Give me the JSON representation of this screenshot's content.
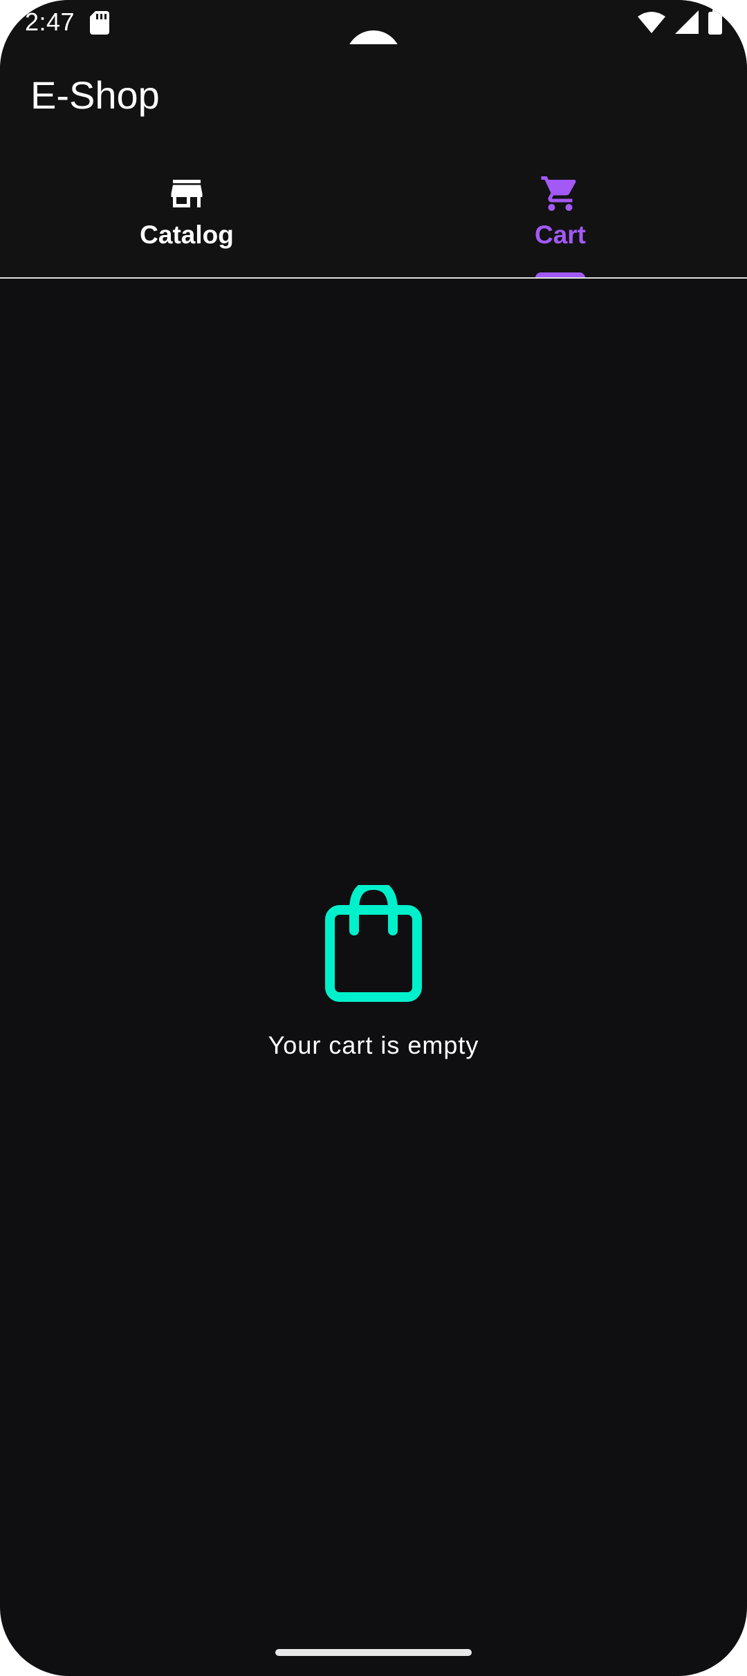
{
  "status_bar": {
    "time": "2:47",
    "icons": [
      "sd-card-icon",
      "wifi-icon",
      "signal-icon",
      "battery-icon"
    ]
  },
  "app_bar": {
    "title": "E-Shop"
  },
  "tabs": [
    {
      "label": "Catalog",
      "icon": "store-icon",
      "selected": false
    },
    {
      "label": "Cart",
      "icon": "cart-icon",
      "selected": true
    }
  ],
  "empty_state": {
    "icon": "shopping-bag-icon",
    "message": "Your cart is empty"
  },
  "colors": {
    "background": "#0f0f11",
    "surface": "#121212",
    "accent": "#a259f5",
    "empty_icon": "#00f0cc",
    "text": "#ffffff"
  }
}
